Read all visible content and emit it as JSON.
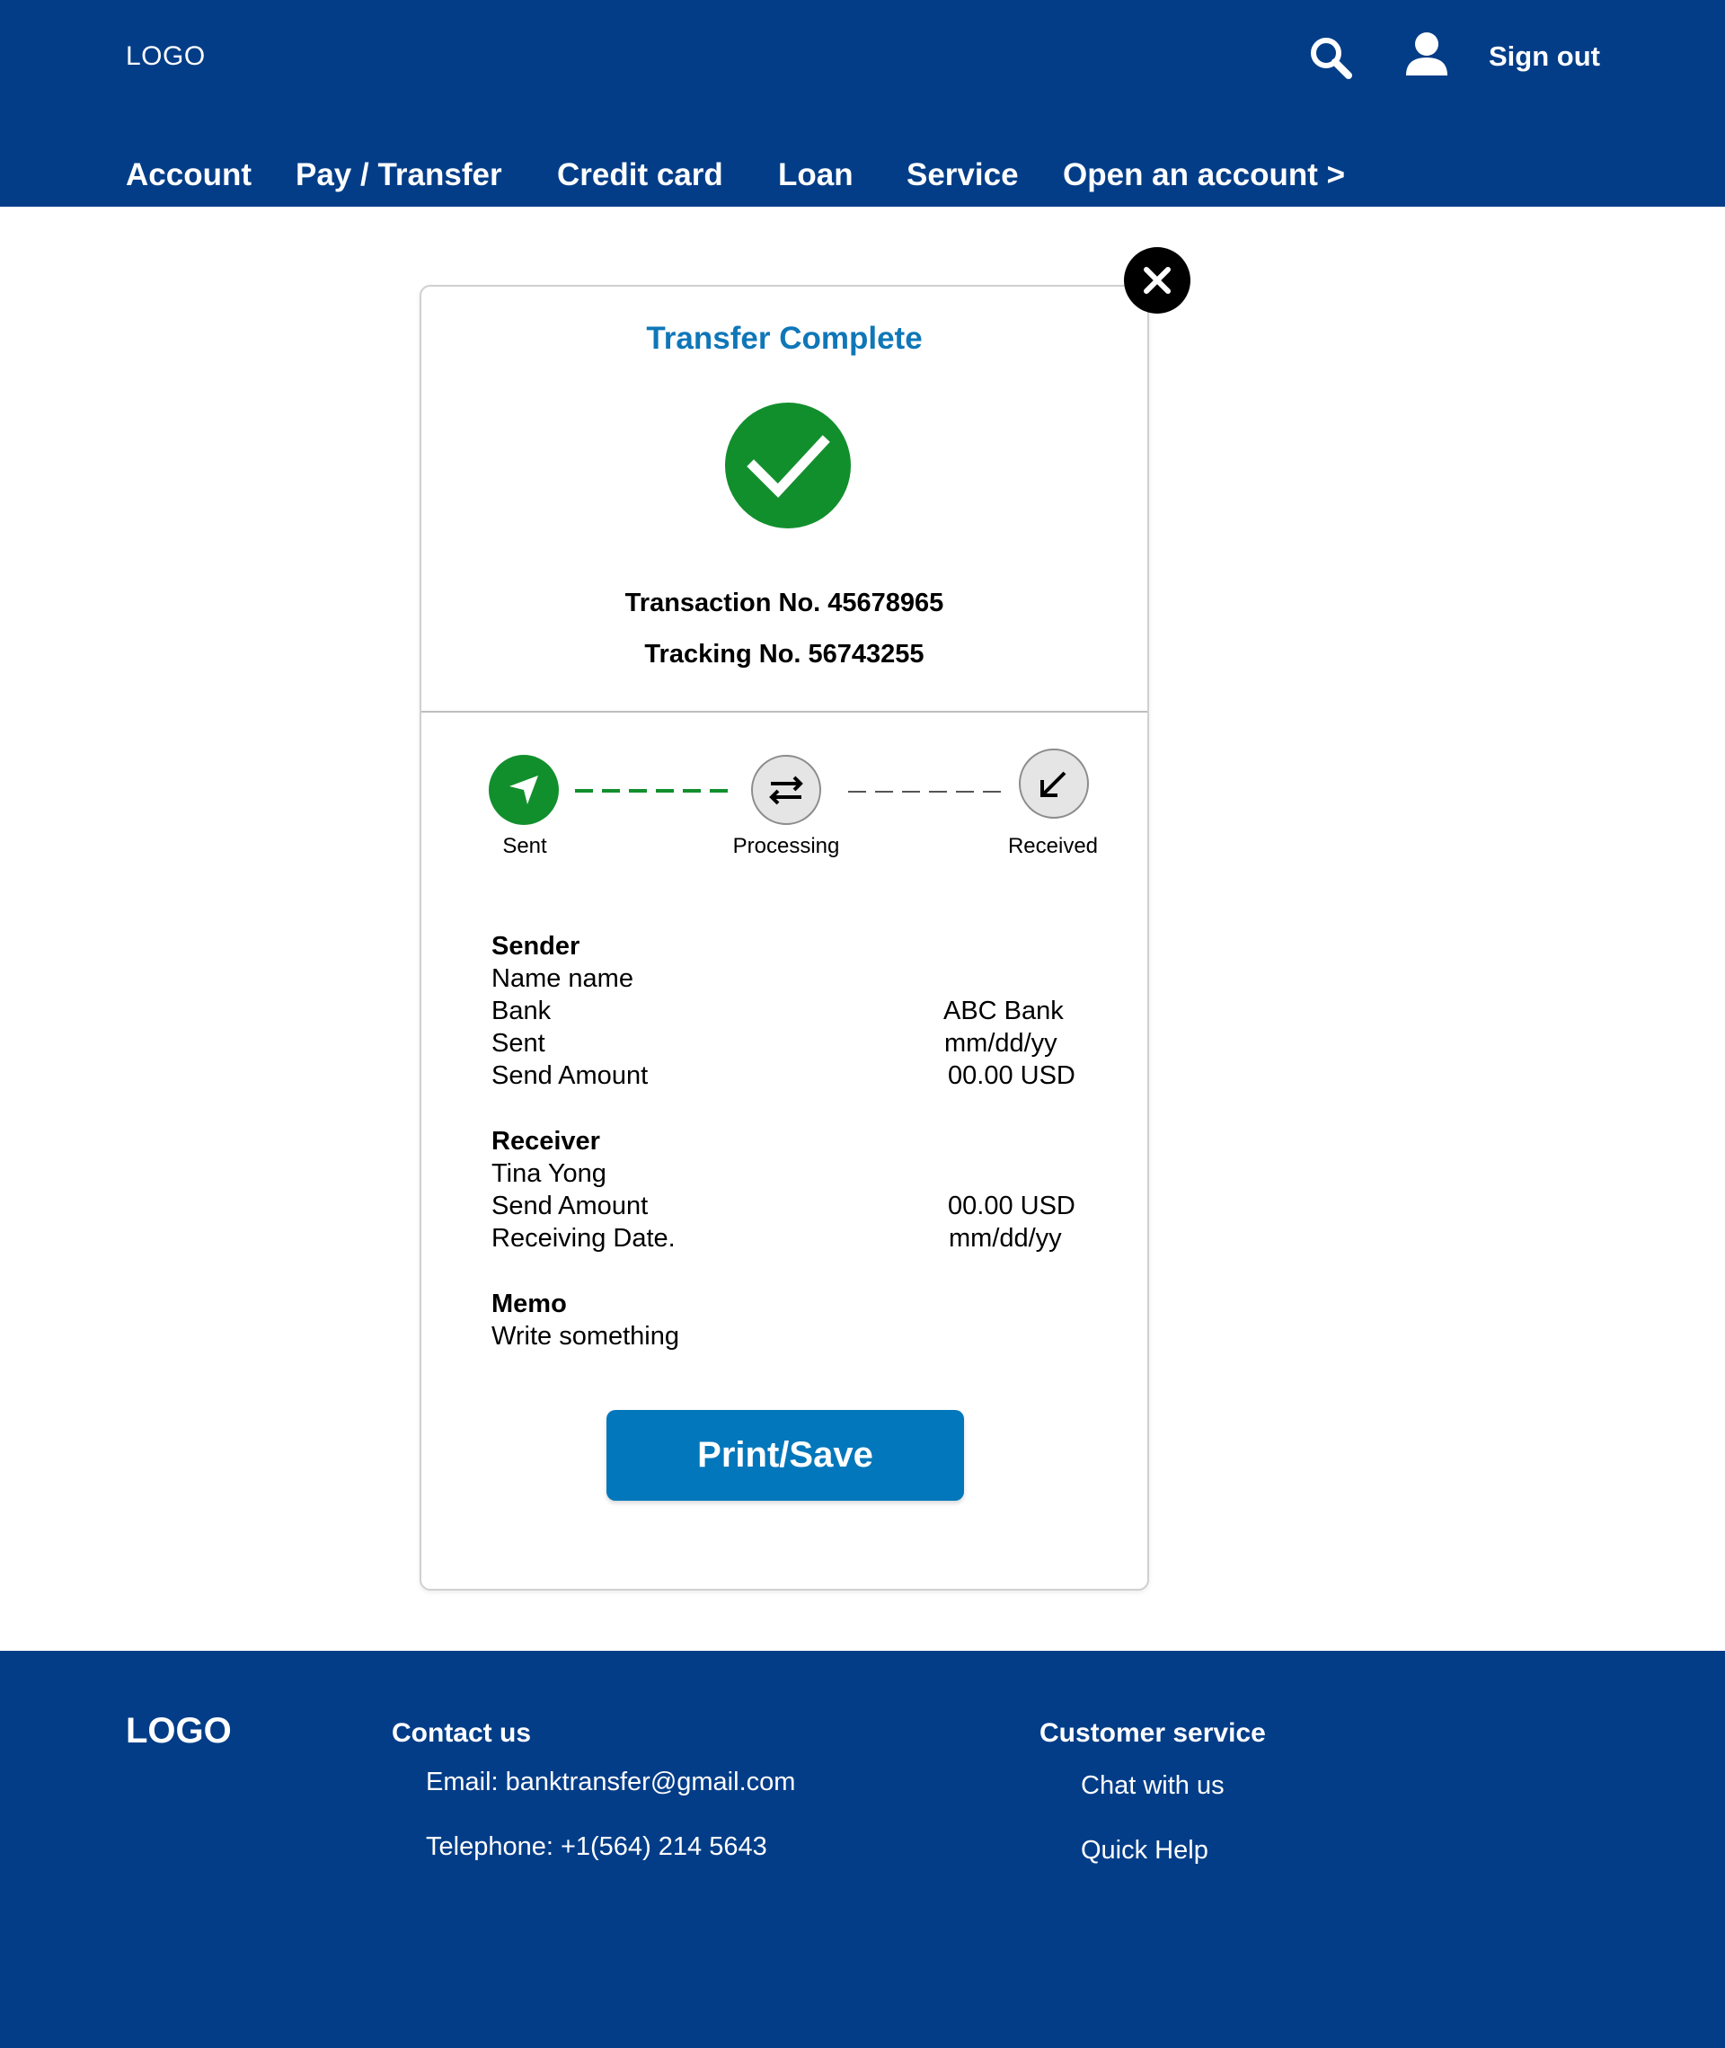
{
  "header": {
    "logo": "LOGO",
    "sign_out": "Sign out",
    "icons": [
      "search-icon",
      "user-icon"
    ],
    "nav": [
      {
        "label": "Account"
      },
      {
        "label": "Pay / Transfer"
      },
      {
        "label": "Credit card"
      },
      {
        "label": "Loan"
      },
      {
        "label": "Service"
      },
      {
        "label": "Open an account >"
      }
    ]
  },
  "modal": {
    "title": "Transfer Complete",
    "transaction": "Transaction No. 45678965",
    "tracking": "Tracking No. 56743255",
    "steps": [
      {
        "label": "Sent",
        "icon": "send-icon",
        "state": "done"
      },
      {
        "label": "Processing",
        "icon": "transfer-arrows-icon",
        "state": "pending"
      },
      {
        "label": "Received",
        "icon": "arrow-down-left-icon",
        "state": "pending"
      }
    ],
    "sender": {
      "heading": "Sender",
      "name": "Name name",
      "bank_label": "Bank",
      "bank_value": "ABC Bank",
      "sent_label": "Sent",
      "sent_value": "mm/dd/yy",
      "amount_label": "Send Amount",
      "amount_value": "00.00 USD"
    },
    "receiver": {
      "heading": "Receiver",
      "name": "Tina Yong",
      "amount_label": "Send Amount",
      "amount_value": "00.00 USD",
      "date_label": "Receiving Date.",
      "date_value": "mm/dd/yy"
    },
    "memo": {
      "heading": "Memo",
      "value": "Write something"
    },
    "print_button": "Print/Save"
  },
  "footer": {
    "logo": "LOGO",
    "contact_heading": "Contact us",
    "email": "Email: banktransfer@gmail.com",
    "telephone": "Telephone: +1(564) 214 5643",
    "service_heading": "Customer service",
    "chat": "Chat with us",
    "help": "Quick Help"
  },
  "colors": {
    "brand_blue": "#033d88",
    "accent_blue": "#0377bb",
    "title_blue": "#0f77b8",
    "success_green": "#128f2d"
  }
}
